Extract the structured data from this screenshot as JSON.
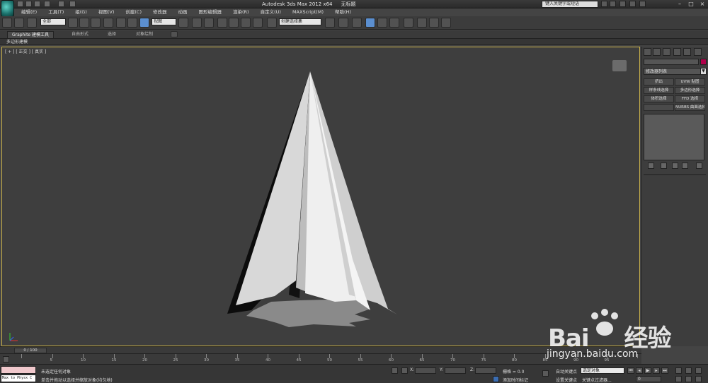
{
  "app": {
    "title": "Autodesk 3ds Max  2012 x64",
    "document": "无标题",
    "search_placeholder": "键入关键字或短语"
  },
  "menus": [
    "编辑(E)",
    "工具(T)",
    "组(G)",
    "视图(V)",
    "创建(C)",
    "修改器",
    "动画",
    "图形编辑器",
    "渲染(R)",
    "自定义(U)",
    "MAXScript(M)",
    "帮助(H)"
  ],
  "toolbar": {
    "selection_filter": "全部",
    "reference_coord": "视图",
    "named_selection": "创建选择集"
  },
  "ribbon": {
    "tabs": [
      "Graphite 建模工具",
      "自由形式",
      "选择",
      "对象绘制"
    ],
    "active_tab": "Graphite 建模工具",
    "sub_label": "多边形建模"
  },
  "viewport": {
    "label": "[ + ] [ 正交 ] [ 真实 ]"
  },
  "command_panel": {
    "modifier_list": "修改器列表",
    "modifier_buttons": [
      "挤出",
      "UVW 贴图",
      "样条线选择",
      "多边形选择",
      "体积选择",
      "FFD 选择",
      "",
      "NURBS 曲面选择"
    ]
  },
  "timeline": {
    "frame_label": "0 / 100",
    "ticks": [
      "0",
      "5",
      "10",
      "15",
      "20",
      "25",
      "30",
      "35",
      "40",
      "45",
      "50",
      "55",
      "60",
      "65",
      "70",
      "75",
      "80",
      "85",
      "90",
      "95",
      "100"
    ]
  },
  "status": {
    "maxscript_text": "Max to Physx C",
    "line1": "未选定任何对象",
    "line2": "单击并拖动以选择并缩放对象(均匀地)",
    "x_label": "X:",
    "y_label": "Y:",
    "z_label": "Z:",
    "grid": "栅格 = 0.0",
    "add_time_tag": "添加时间标记",
    "auto_key": "自动关键点",
    "set_key": "设置关键点",
    "key_mode": "选定对象",
    "key_filters": "关键点过滤器...",
    "frame": "0"
  },
  "watermark": {
    "brand": "Bai",
    "brand_cn": "经验",
    "url": "jingyan.baidu.com"
  }
}
